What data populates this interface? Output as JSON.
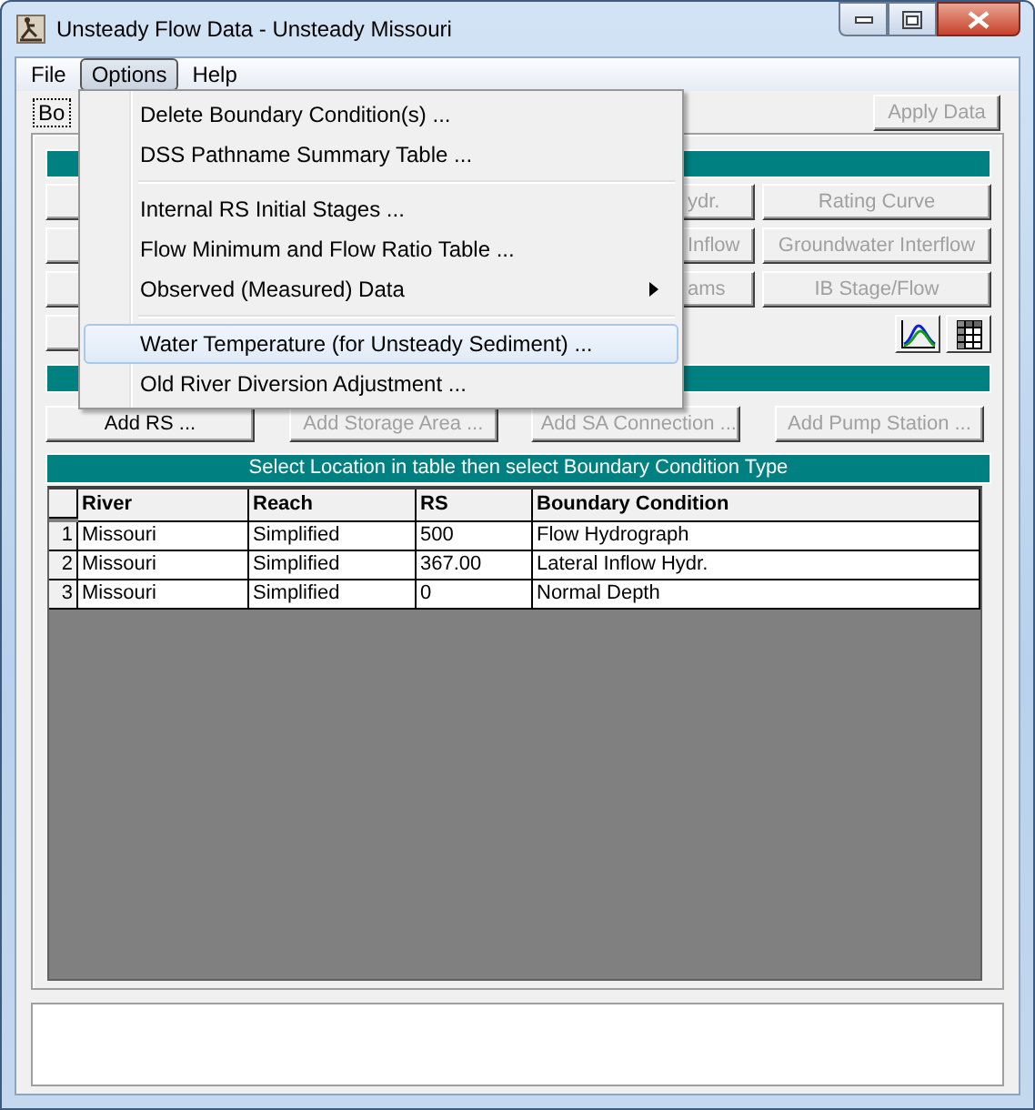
{
  "window": {
    "title": "Unsteady Flow Data - Unsteady Missouri"
  },
  "menu_bar": [
    {
      "label": "File",
      "selected": false
    },
    {
      "label": "Options",
      "selected": true
    },
    {
      "label": "Help",
      "selected": false
    }
  ],
  "options_menu": [
    [
      {
        "label": "Delete Boundary Condition(s) ...",
        "highlighted": false,
        "submenu": false
      },
      {
        "label": "DSS Pathname Summary Table ...",
        "highlighted": false,
        "submenu": false
      }
    ],
    [
      {
        "label": "Internal RS Initial Stages ...",
        "highlighted": false,
        "submenu": false
      },
      {
        "label": "Flow Minimum and Flow Ratio Table ...",
        "highlighted": false,
        "submenu": false
      },
      {
        "label": "Observed (Measured) Data",
        "highlighted": false,
        "submenu": true
      }
    ],
    [
      {
        "label": "Water Temperature (for Unsteady Sediment) ...",
        "highlighted": true,
        "submenu": false
      },
      {
        "label": "Old River Diversion Adjustment ...",
        "highlighted": false,
        "submenu": false
      }
    ]
  ],
  "checkbox": {
    "label": "Bo"
  },
  "apply_button": {
    "label": "Apply Data",
    "disabled": true
  },
  "boundary_buttons": [
    [
      "ydr.",
      "Rating Curve"
    ],
    [
      "Inflow",
      "Groundwater Interflow"
    ],
    [
      "ams",
      "IB Stage/Flow"
    ]
  ],
  "add_buttons": [
    {
      "label": "Add RS ...",
      "disabled": false
    },
    {
      "label": "Add Storage Area ...",
      "disabled": true
    },
    {
      "label": "Add SA Connection ...",
      "disabled": true
    },
    {
      "label": "Add Pump Station ...",
      "disabled": true
    }
  ],
  "table": {
    "caption": "Select Location in table then select Boundary Condition Type",
    "columns": [
      "River",
      "Reach",
      "RS",
      "Boundary Condition"
    ],
    "rows": [
      {
        "number": "1",
        "cells": [
          "Missouri",
          "Simplified",
          "500",
          "Flow Hydrograph"
        ]
      },
      {
        "number": "2",
        "cells": [
          "Missouri",
          "Simplified",
          "367.00",
          "Lateral Inflow Hydr."
        ]
      },
      {
        "number": "3",
        "cells": [
          "Missouri",
          "Simplified",
          "0",
          "Normal Depth"
        ]
      }
    ]
  }
}
